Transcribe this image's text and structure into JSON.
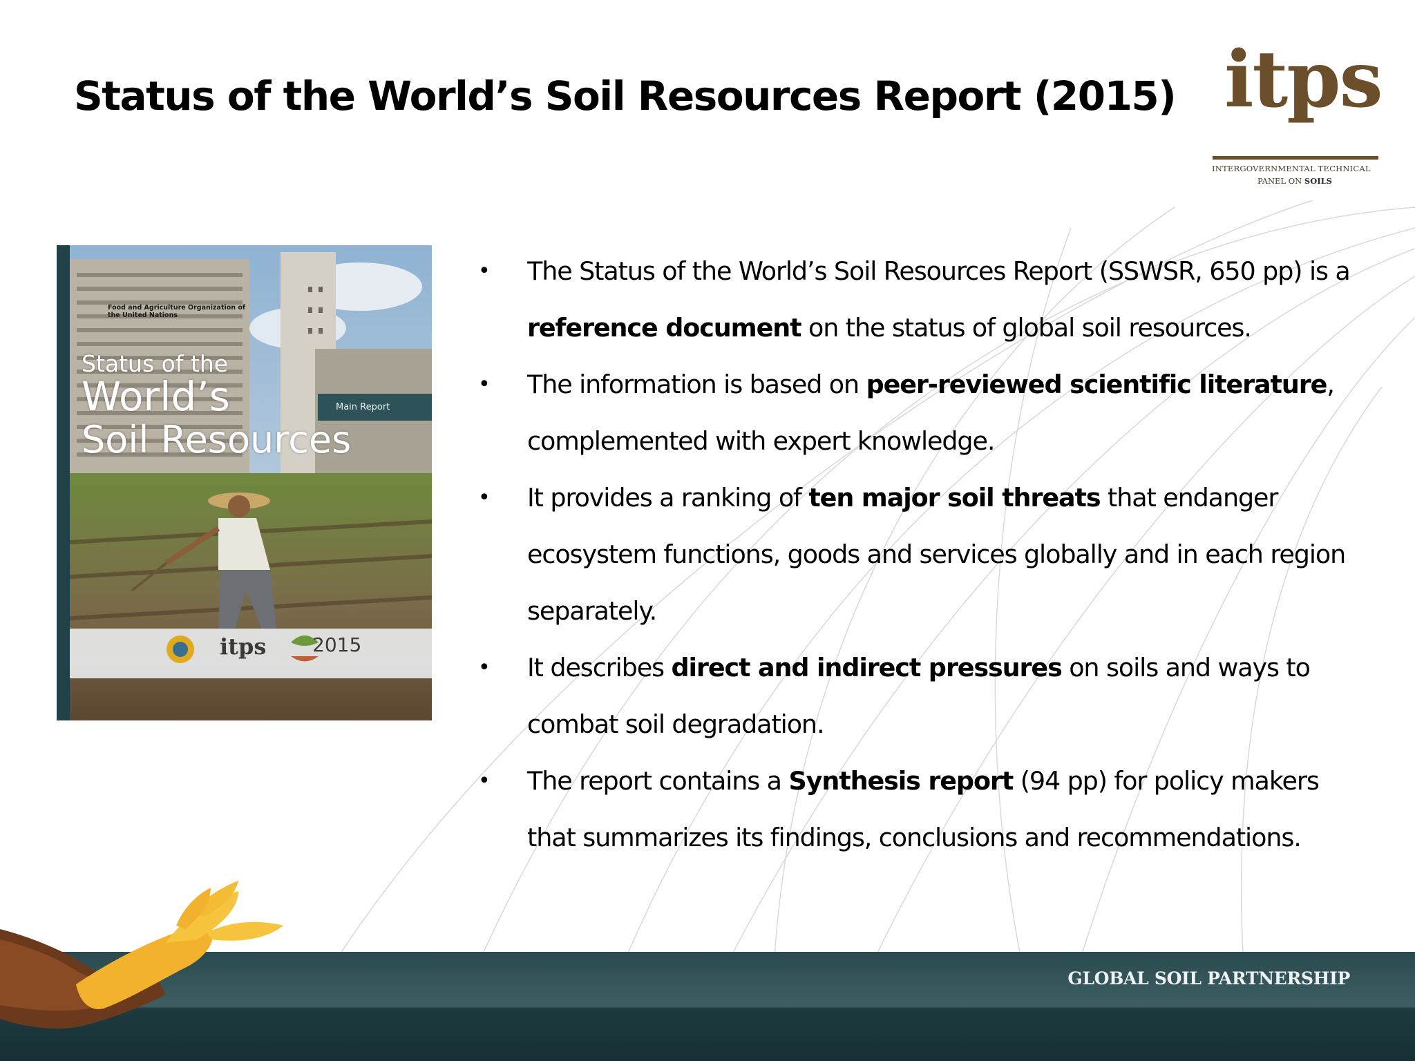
{
  "slide": {
    "title": "Status of the World’s Soil Resources Report (2015)"
  },
  "logo": {
    "wordmark": "itps",
    "line1": "INTERGOVERNMENTAL TECHNICAL",
    "line2_prefix": "PANEL ON ",
    "line2_bold": "SOILS",
    "brand_color": "#6b4e2a"
  },
  "cover": {
    "org": "Food and Agriculture Organization of the United Nations",
    "title_line1": "Status of the",
    "title_line2": "World’s",
    "title_line3": "Soil Resources",
    "badge": "Main Report",
    "itps": "itps",
    "year": "2015"
  },
  "bullets": [
    {
      "before": "The Status of the World’s Soil Resources Report (SSWSR, 650 pp) is a ",
      "bold": "reference document",
      "after": " on the status of global soil resources."
    },
    {
      "before": "The information is based on ",
      "bold": "peer-reviewed scientific literature",
      "after": ", complemented with expert knowledge."
    },
    {
      "before": "It provides a ranking of ",
      "bold": "ten major soil threats",
      "after": " that endanger ecosystem functions, goods and services globally and in each region separately."
    },
    {
      "before": "It describes ",
      "bold": "direct and indirect pressures",
      "after": " on soils and ways to combat soil degradation."
    },
    {
      "before": "The report contains a ",
      "bold": "Synthesis report",
      "after": "  (94 pp) for policy makers that summarizes its findings, conclusions and recommendations."
    }
  ],
  "bullet_symbol": "•",
  "footer": {
    "label": "GLOBAL SOIL PARTNERSHIP",
    "band_color": "#1f3d41"
  }
}
